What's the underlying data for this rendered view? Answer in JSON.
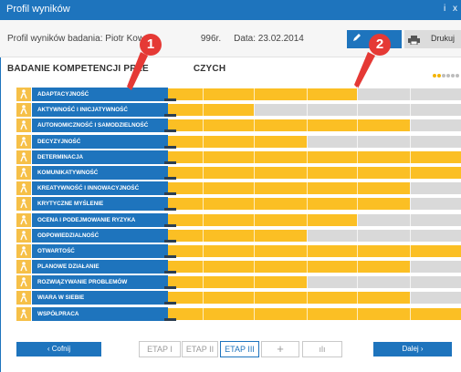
{
  "window": {
    "title": "Profil wyników",
    "info_icon": "i",
    "close_icon": "x"
  },
  "header": {
    "info_left": "Profil wyników badania: Piotr Kowal",
    "info_mid": "996r.",
    "date": "Data: 23.02.2014",
    "print_label": "Drukuj"
  },
  "section": {
    "title": "BADANIE KOMPETENCJI PRZE",
    "title_tail": "CZYCH"
  },
  "markers": [
    "1",
    "2"
  ],
  "rows": [
    {
      "label": "ADAPTACYJNOŚĆ",
      "icon": "person-icon",
      "value": 0.665
    },
    {
      "label": "AKTYWNOŚĆ I INICJATYWNOŚĆ",
      "icon": "runner-icon",
      "value": 0.33
    },
    {
      "label": "AUTONOMICZNOŚĆ I SAMODZIELNOŚĆ",
      "icon": "walker-icon",
      "value": 0.835
    },
    {
      "label": "DECYZYJNOŚĆ",
      "icon": "figure-icon",
      "value": 0.5
    },
    {
      "label": "DETERMINACJA",
      "icon": "climber-icon",
      "value": 1.0
    },
    {
      "label": "KOMUNIKATYWNOŚĆ",
      "icon": "speech-bubble-icon",
      "value": 1.0
    },
    {
      "label": "KREATYWNOŚĆ I INNOWACYJNOŚĆ",
      "icon": "lightbulb-icon",
      "value": 0.835
    },
    {
      "label": "KRYTYCZNE MYŚLENIE",
      "icon": "magnifier-icon",
      "value": 0.835
    },
    {
      "label": "OCENA I PODEJMOWANIE RYZYKA",
      "icon": "acrobat-icon",
      "value": 0.665
    },
    {
      "label": "ODPOWIEDZIALNOŚĆ",
      "icon": "hand-icon",
      "value": 0.5
    },
    {
      "label": "OTWARTOŚĆ",
      "icon": "door-icon",
      "value": 1.0
    },
    {
      "label": "PLANOWE DZIAŁANIE",
      "icon": "checklist-icon",
      "value": 0.835
    },
    {
      "label": "ROZWIĄZYWANIE PROBLEMÓW",
      "icon": "gear-icon",
      "value": 0.5
    },
    {
      "label": "WIARA W SIEBIE",
      "icon": "cheering-person-icon",
      "value": 0.835
    },
    {
      "label": "WSPÓŁPRACA",
      "icon": "handshake-icon",
      "value": 1.0
    }
  ],
  "footer": {
    "prev_label": "‹  Cofnij",
    "next_label": "Dalej  ›",
    "etaps": [
      "ETAP I",
      "ETAP II",
      "ETAP III",
      "+",
      "ılı"
    ],
    "active_etap": "ETAP III"
  },
  "colors": {
    "brand": "#1e74bd",
    "fill": "#fbbf24",
    "empty": "#d9d9d9",
    "marker": "#e53935"
  }
}
